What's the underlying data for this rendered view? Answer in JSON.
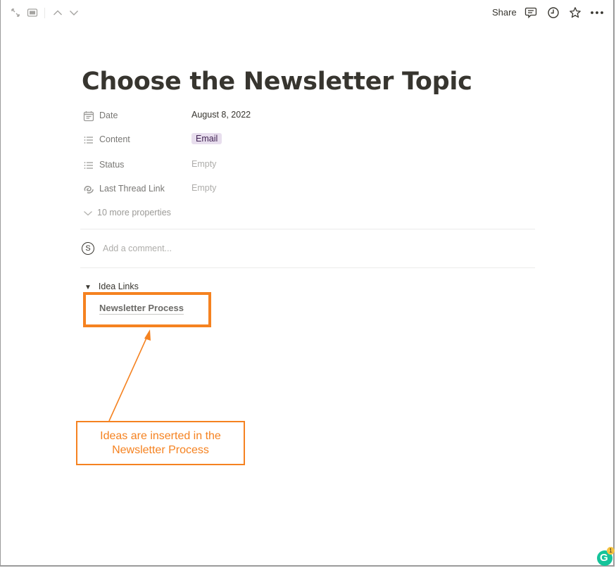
{
  "toolbar": {
    "left_icons": [
      "expand-icon",
      "peek-mode-icon",
      "chevron-up-icon",
      "chevron-down-icon"
    ],
    "share_label": "Share",
    "right_icons": [
      "comments-icon",
      "updates-clock-icon",
      "favorite-star-icon",
      "more-options-icon"
    ]
  },
  "page": {
    "title": "Choose the Newsletter Topic",
    "properties": [
      {
        "icon": "calendar-icon",
        "name": "Date",
        "value": "August 8, 2022",
        "empty": false
      },
      {
        "icon": "list-icon",
        "name": "Content",
        "value": "Email",
        "type": "tag",
        "tag_color": "#e8deee"
      },
      {
        "icon": "list-icon",
        "name": "Status",
        "value": "Empty",
        "empty": true
      },
      {
        "icon": "thread-link-icon",
        "name": "Last Thread Link",
        "value": "Empty",
        "empty": true
      }
    ],
    "more_properties": "10 more properties",
    "comment": {
      "avatar_letter": "S",
      "placeholder": "Add a comment..."
    },
    "toggle": {
      "label": "Idea Links",
      "link": "Newsletter Process"
    }
  },
  "annotation": {
    "text_line1": "Ideas are inserted in the",
    "text_line2": "Newsletter Process",
    "color": "#f58220"
  },
  "grammarly": {
    "letter": "G",
    "badge_count": "1"
  }
}
